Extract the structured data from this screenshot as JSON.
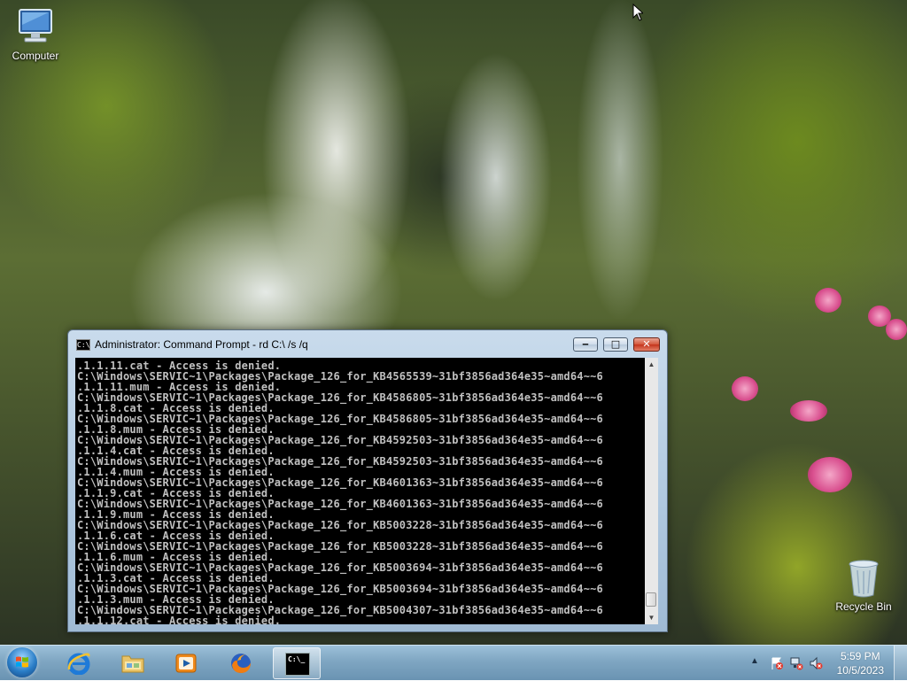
{
  "desktop": {
    "icons": [
      {
        "label": "Computer",
        "icon": "computer-icon"
      },
      {
        "label": "Recycle Bin",
        "icon": "recycle-bin-icon"
      }
    ]
  },
  "cmd_window": {
    "title": "Administrator:  Command Prompt - rd  C:\\ /s /q",
    "icon_text": "C:\\",
    "minimize_glyph": "‒",
    "maximize_glyph": "□",
    "close_glyph": "✕",
    "console_lines": [
      ".1.1.11.cat - Access is denied.",
      "C:\\Windows\\SERVIC~1\\Packages\\Package_126_for_KB4565539~31bf3856ad364e35~amd64~~6",
      ".1.1.11.mum - Access is denied.",
      "C:\\Windows\\SERVIC~1\\Packages\\Package_126_for_KB4586805~31bf3856ad364e35~amd64~~6",
      ".1.1.8.cat - Access is denied.",
      "C:\\Windows\\SERVIC~1\\Packages\\Package_126_for_KB4586805~31bf3856ad364e35~amd64~~6",
      ".1.1.8.mum - Access is denied.",
      "C:\\Windows\\SERVIC~1\\Packages\\Package_126_for_KB4592503~31bf3856ad364e35~amd64~~6",
      ".1.1.4.cat - Access is denied.",
      "C:\\Windows\\SERVIC~1\\Packages\\Package_126_for_KB4592503~31bf3856ad364e35~amd64~~6",
      ".1.1.4.mum - Access is denied.",
      "C:\\Windows\\SERVIC~1\\Packages\\Package_126_for_KB4601363~31bf3856ad364e35~amd64~~6",
      ".1.1.9.cat - Access is denied.",
      "C:\\Windows\\SERVIC~1\\Packages\\Package_126_for_KB4601363~31bf3856ad364e35~amd64~~6",
      ".1.1.9.mum - Access is denied.",
      "C:\\Windows\\SERVIC~1\\Packages\\Package_126_for_KB5003228~31bf3856ad364e35~amd64~~6",
      ".1.1.6.cat - Access is denied.",
      "C:\\Windows\\SERVIC~1\\Packages\\Package_126_for_KB5003228~31bf3856ad364e35~amd64~~6",
      ".1.1.6.mum - Access is denied.",
      "C:\\Windows\\SERVIC~1\\Packages\\Package_126_for_KB5003694~31bf3856ad364e35~amd64~~6",
      ".1.1.3.cat - Access is denied.",
      "C:\\Windows\\SERVIC~1\\Packages\\Package_126_for_KB5003694~31bf3856ad364e35~amd64~~6",
      ".1.1.3.mum - Access is denied.",
      "C:\\Windows\\SERVIC~1\\Packages\\Package_126_for_KB5004307~31bf3856ad364e35~amd64~~6",
      ".1.1.12.cat - Access is denied."
    ]
  },
  "taskbar": {
    "pinned": [
      {
        "name": "internet-explorer",
        "icon": "internet-explorer-icon"
      },
      {
        "name": "windows-explorer",
        "icon": "folder-icon"
      },
      {
        "name": "media-player",
        "icon": "media-player-icon"
      },
      {
        "name": "firefox",
        "icon": "firefox-icon"
      },
      {
        "name": "command-prompt",
        "icon": "command-prompt-icon",
        "active": true
      }
    ],
    "cmd_icon_text": "C:\\_",
    "tray": {
      "show_hidden_glyph": "▲",
      "icons": [
        "action-center-icon",
        "network-icon",
        "volume-muted-icon"
      ]
    },
    "clock": {
      "time": "5:59 PM",
      "date": "10/5/2023"
    }
  },
  "colors": {
    "console_bg": "#000000",
    "console_fg": "#c0c0c0",
    "window_frame": "#aec7df",
    "close_button": "#c3331b",
    "taskbar": "#7fa6c2"
  }
}
